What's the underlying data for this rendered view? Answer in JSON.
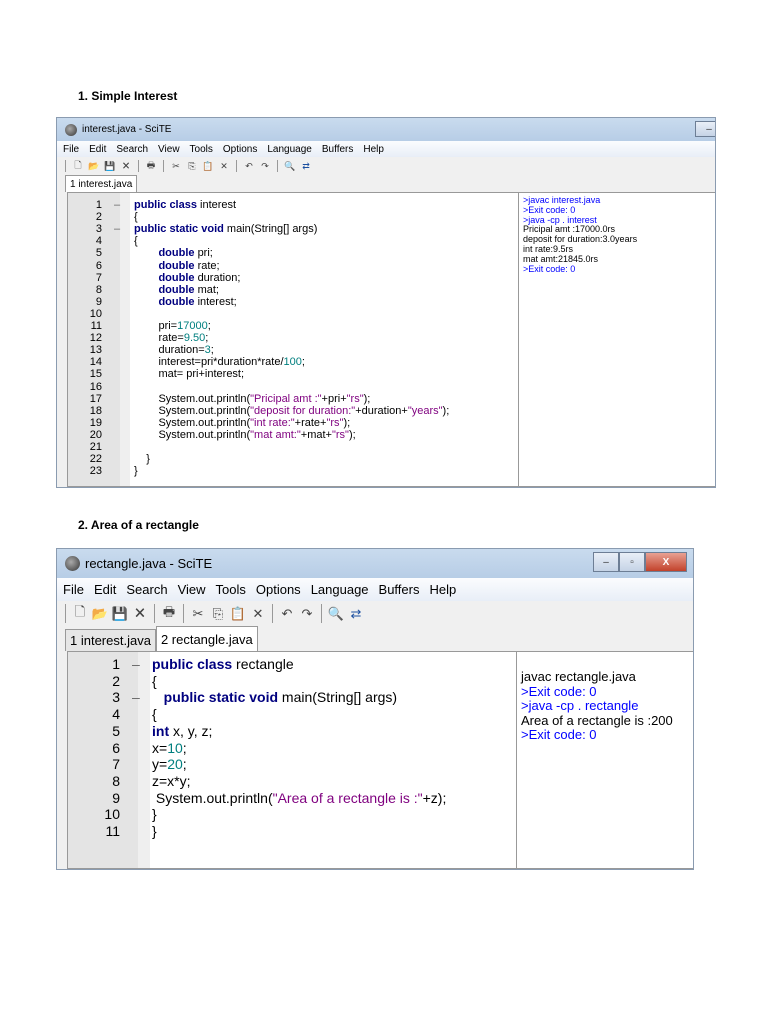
{
  "sections": [
    {
      "heading": "1.   Simple Interest",
      "window_title": "interest.java - SciTE",
      "menu": [
        "File",
        "Edit",
        "Search",
        "View",
        "Tools",
        "Options",
        "Language",
        "Buffers",
        "Help"
      ],
      "tabs": [
        "1 interest.java"
      ],
      "code": [
        [
          [
            "kw",
            "public class "
          ],
          [
            "t",
            "interest"
          ]
        ],
        [
          [
            "t",
            "{"
          ]
        ],
        [
          [
            "kw",
            "public static void "
          ],
          [
            "t",
            "main(String[] args)"
          ]
        ],
        [
          [
            "t",
            "{"
          ]
        ],
        [
          [
            "t",
            "        "
          ],
          [
            "kw",
            "double "
          ],
          [
            "t",
            "pri;"
          ]
        ],
        [
          [
            "t",
            "        "
          ],
          [
            "kw",
            "double "
          ],
          [
            "t",
            "rate;"
          ]
        ],
        [
          [
            "t",
            "        "
          ],
          [
            "kw",
            "double "
          ],
          [
            "t",
            "duration;"
          ]
        ],
        [
          [
            "t",
            "        "
          ],
          [
            "kw",
            "double "
          ],
          [
            "t",
            "mat;"
          ]
        ],
        [
          [
            "t",
            "        "
          ],
          [
            "kw",
            "double "
          ],
          [
            "t",
            "interest;"
          ]
        ],
        [],
        [
          [
            "t",
            "        pri="
          ],
          [
            "num",
            "17000"
          ],
          [
            "t",
            ";"
          ]
        ],
        [
          [
            "t",
            "        rate="
          ],
          [
            "num",
            "9.50"
          ],
          [
            "t",
            ";"
          ]
        ],
        [
          [
            "t",
            "        duration="
          ],
          [
            "num",
            "3"
          ],
          [
            "t",
            ";"
          ]
        ],
        [
          [
            "t",
            "        interest=pri*duration*rate/"
          ],
          [
            "num",
            "100"
          ],
          [
            "t",
            ";"
          ]
        ],
        [
          [
            "t",
            "        mat= pri+interest;"
          ]
        ],
        [],
        [
          [
            "t",
            "        System.out.println("
          ],
          [
            "str",
            "\"Pricipal amt :\""
          ],
          [
            "t",
            "+pri+"
          ],
          [
            "str",
            "\"rs\""
          ],
          [
            "t",
            ");"
          ]
        ],
        [
          [
            "t",
            "        System.out.println("
          ],
          [
            "str",
            "\"deposit for duration:\""
          ],
          [
            "t",
            "+duration+"
          ],
          [
            "str",
            "\"years\""
          ],
          [
            "t",
            ");"
          ]
        ],
        [
          [
            "t",
            "        System.out.println("
          ],
          [
            "str",
            "\"int rate:\""
          ],
          [
            "t",
            "+rate+"
          ],
          [
            "str",
            "\"rs\""
          ],
          [
            "t",
            ");"
          ]
        ],
        [
          [
            "t",
            "        System.out.println("
          ],
          [
            "str",
            "\"mat amt:\""
          ],
          [
            "t",
            "+mat+"
          ],
          [
            "str",
            "\"rs\""
          ],
          [
            "t",
            ");"
          ]
        ],
        [],
        [
          [
            "t",
            "    }"
          ]
        ],
        [
          [
            "t",
            "}"
          ]
        ]
      ],
      "folds": {
        "1": "-",
        "3": "-"
      },
      "output": [
        {
          "text": ">javac interest.java",
          "color": "blue"
        },
        {
          "text": ">Exit code: 0",
          "color": "blue"
        },
        {
          "text": ">java -cp . interest",
          "color": "blue"
        },
        {
          "text": "Pricipal amt :17000.0rs",
          "color": "black"
        },
        {
          "text": "deposit for duration:3.0years",
          "color": "black"
        },
        {
          "text": "int rate:9.5rs",
          "color": "black"
        },
        {
          "text": "mat amt:21845.0rs",
          "color": "black"
        },
        {
          "text": ">Exit code: 0",
          "color": "blue"
        }
      ]
    },
    {
      "heading": "2.   Area of a rectangle",
      "window_title": "rectangle.java - SciTE",
      "menu": [
        "File",
        "Edit",
        "Search",
        "View",
        "Tools",
        "Options",
        "Language",
        "Buffers",
        "Help"
      ],
      "tabs": [
        "1 interest.java",
        "2 rectangle.java"
      ],
      "code": [
        [
          [
            "kw",
            "public class "
          ],
          [
            "t",
            "rectangle"
          ]
        ],
        [
          [
            "t",
            "{"
          ]
        ],
        [
          [
            "t",
            "   "
          ],
          [
            "kw",
            "public static void "
          ],
          [
            "t",
            "main(String[] args)"
          ]
        ],
        [
          [
            "t",
            "{"
          ]
        ],
        [
          [
            "kw",
            "int "
          ],
          [
            "t",
            "x, y, z;"
          ]
        ],
        [
          [
            "t",
            "x="
          ],
          [
            "num",
            "10"
          ],
          [
            "t",
            ";"
          ]
        ],
        [
          [
            "t",
            "y="
          ],
          [
            "num",
            "20"
          ],
          [
            "t",
            ";"
          ]
        ],
        [
          [
            "t",
            "z=x*y;"
          ]
        ],
        [
          [
            "t",
            " System.out.println("
          ],
          [
            "str",
            "\"Area of a rectangle is :\""
          ],
          [
            "t",
            "+z);"
          ]
        ],
        [
          [
            "t",
            "}"
          ]
        ],
        [
          [
            "t",
            "}"
          ]
        ]
      ],
      "folds": {
        "1": "-",
        "3": "-"
      },
      "output": [
        {
          "text": "javac rectangle.java",
          "color": "black"
        },
        {
          "text": ">Exit code: 0",
          "color": "blue"
        },
        {
          "text": ">java -cp . rectangle",
          "color": "blue"
        },
        {
          "text": "Area of a rectangle is :200",
          "color": "black"
        },
        {
          "text": ">Exit code: 0",
          "color": "blue"
        }
      ]
    }
  ],
  "toolbar_icons": [
    "new-file",
    "open-folder",
    "save",
    "close-file",
    "|",
    "print",
    "|",
    "cut",
    "copy",
    "paste",
    "delete",
    "|",
    "undo",
    "redo",
    "|",
    "find",
    "replace"
  ]
}
